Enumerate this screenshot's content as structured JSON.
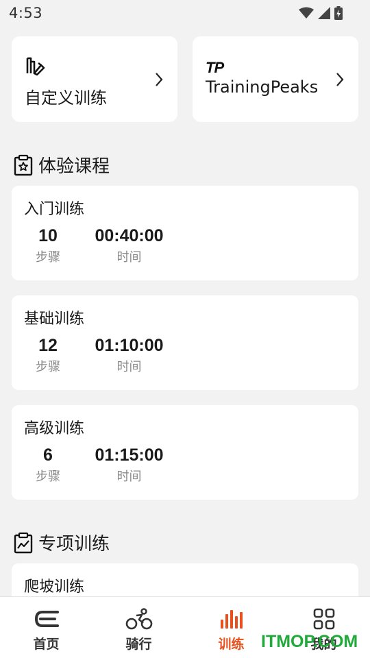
{
  "status_bar": {
    "time": "4:53"
  },
  "top_cards": [
    {
      "label": "自定义训练",
      "icon": "custom-training-icon"
    },
    {
      "label": "TrainingPeaks",
      "logo_text": "TP",
      "icon": "trainingpeaks-logo"
    }
  ],
  "sections": {
    "trial": {
      "title": "体验课程",
      "icon": "clipboard-star-icon"
    },
    "special": {
      "title": "专项训练",
      "icon": "clipboard-chart-icon"
    }
  },
  "courses": [
    {
      "name": "入门训练",
      "steps": "10",
      "steps_label": "步骤",
      "time": "00:40:00",
      "time_label": "时间"
    },
    {
      "name": "基础训练",
      "steps": "12",
      "steps_label": "步骤",
      "time": "01:10:00",
      "time_label": "时间"
    },
    {
      "name": "高级训练",
      "steps": "6",
      "steps_label": "步骤",
      "time": "01:15:00",
      "time_label": "时间"
    }
  ],
  "special_courses": [
    {
      "name": "爬坡训练"
    }
  ],
  "bottom_nav": [
    {
      "label": "首页",
      "icon": "home-icon",
      "active": false
    },
    {
      "label": "骑行",
      "icon": "bike-icon",
      "active": false
    },
    {
      "label": "训练",
      "icon": "training-bars-icon",
      "active": true
    },
    {
      "label": "我的",
      "icon": "grid-icon",
      "active": false
    }
  ],
  "watermark": "ITMOP.COM",
  "colors": {
    "accent": "#e8501e",
    "background": "#f2f2f2",
    "card": "#ffffff",
    "watermark": "#1faa3a"
  }
}
